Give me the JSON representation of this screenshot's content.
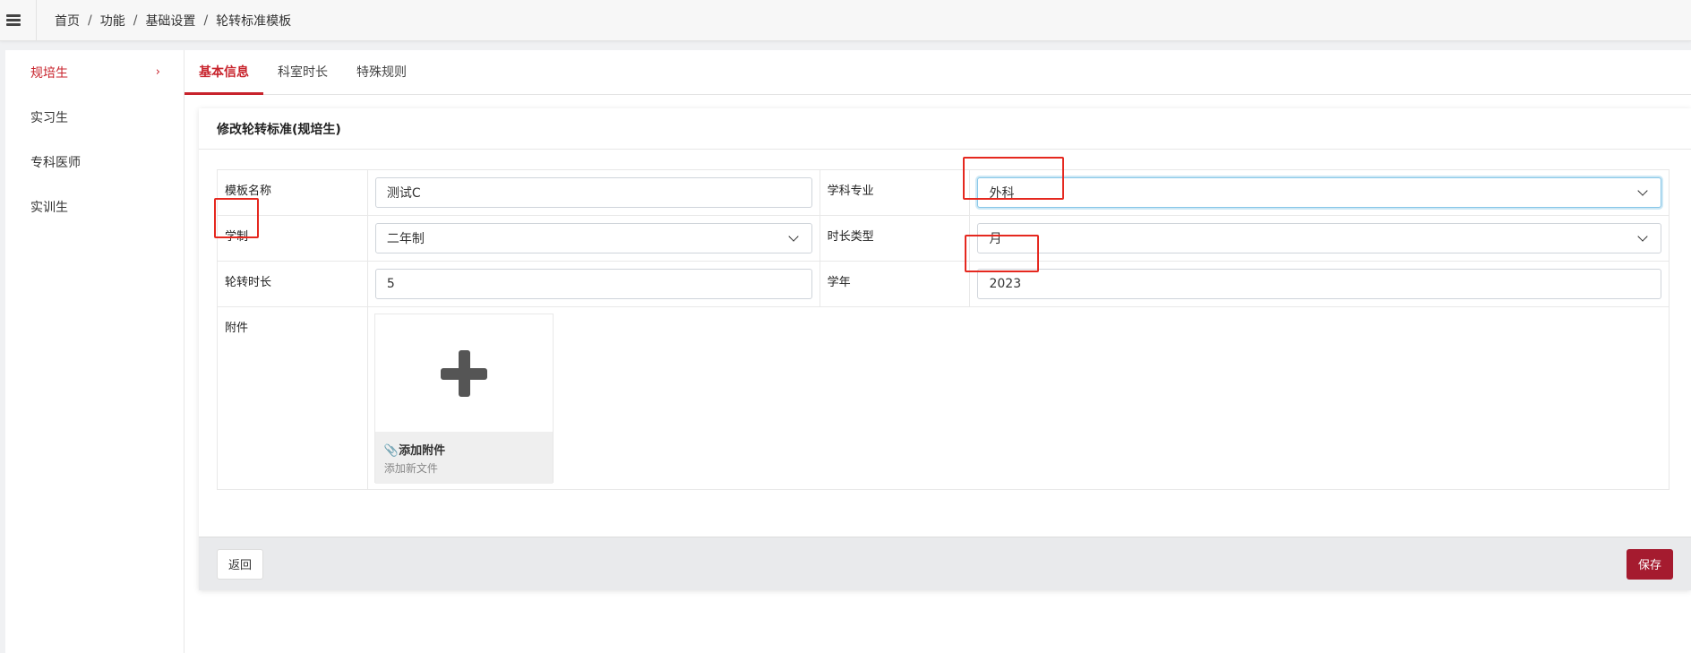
{
  "breadcrumb": [
    {
      "label": "首页"
    },
    {
      "label": "功能"
    },
    {
      "label": "基础设置"
    },
    {
      "label": "轮转标准模板"
    }
  ],
  "breadcrumb_separator": "/",
  "sidebar": {
    "items": [
      {
        "label": "规培生",
        "active": true
      },
      {
        "label": "实习生",
        "active": false
      },
      {
        "label": "专科医师",
        "active": false
      },
      {
        "label": "实训生",
        "active": false
      }
    ],
    "active_chevron": "›"
  },
  "tabs": [
    {
      "label": "基本信息",
      "active": true
    },
    {
      "label": "科室时长",
      "active": false
    },
    {
      "label": "特殊规则",
      "active": false
    }
  ],
  "panel": {
    "title": "修改轮转标准(规培生)"
  },
  "form": {
    "template_name": {
      "label": "模板名称",
      "value": "测试C"
    },
    "specialty": {
      "label": "学科专业",
      "value": "外科"
    },
    "system": {
      "label": "学制",
      "value": "二年制"
    },
    "duration_type": {
      "label": "时长类型",
      "value": "月"
    },
    "rotation_duration": {
      "label": "轮转时长",
      "value": "5"
    },
    "academic_year": {
      "label": "学年",
      "value": "2023"
    },
    "attachment": {
      "label": "附件",
      "upload_title": "📎添加附件",
      "upload_subtitle": "添加新文件"
    }
  },
  "footer": {
    "back_label": "返回",
    "save_label": "保存"
  },
  "colors": {
    "accent": "#c8232c",
    "save_button": "#a51b2f",
    "highlight_box": "#e5281f"
  }
}
